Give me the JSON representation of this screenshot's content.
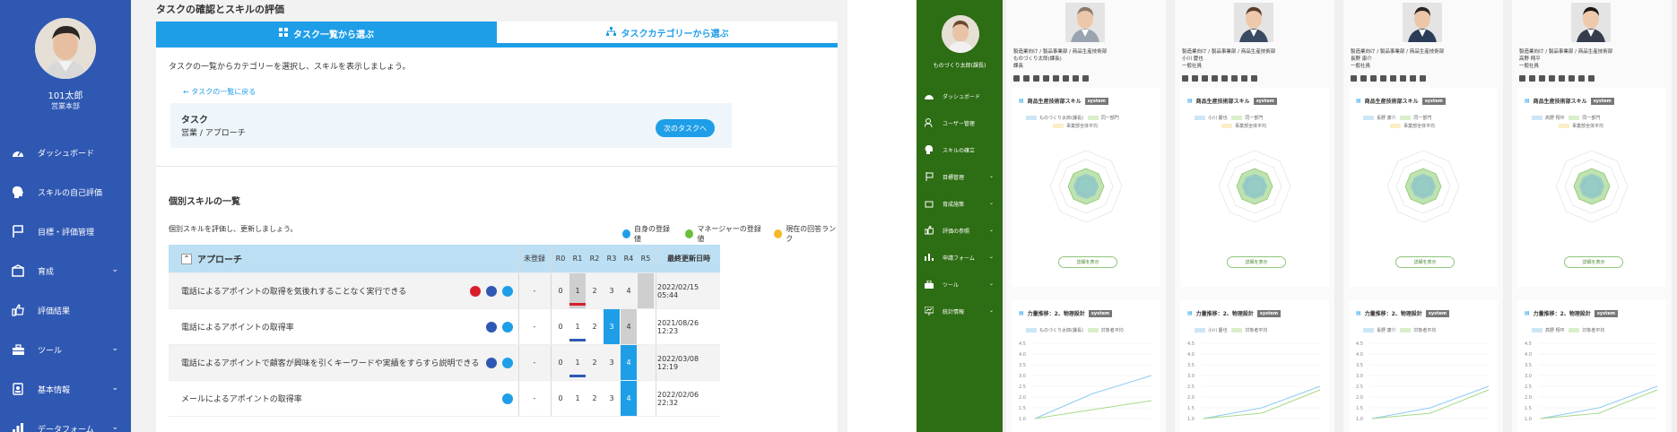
{
  "left": {
    "sidebar": {
      "user_name": "101太郎",
      "user_dept": "営業本部",
      "items": [
        {
          "label": "ダッシュボード",
          "icon": "dashboard-icon",
          "chevron": false
        },
        {
          "label": "スキルの自己評価",
          "icon": "head-icon",
          "chevron": false
        },
        {
          "label": "目標・評価管理",
          "icon": "flag-icon",
          "chevron": false
        },
        {
          "label": "育成",
          "icon": "training-icon",
          "chevron": true
        },
        {
          "label": "評価結果",
          "icon": "thumbs-up-icon",
          "chevron": false
        },
        {
          "label": "ツール",
          "icon": "toolbox-icon",
          "chevron": true
        },
        {
          "label": "基本情報",
          "icon": "id-card-icon",
          "chevron": true
        },
        {
          "label": "データフォーム",
          "icon": "data-form-icon",
          "chevron": true
        }
      ]
    },
    "header": {
      "title": "タスクの確認とスキルの評価"
    },
    "tabs": [
      {
        "label": "タスク一覧から選ぶ",
        "icon": "grid-icon"
      },
      {
        "label": "タスクカテゴリーから選ぶ",
        "icon": "hierarchy-icon"
      }
    ],
    "intro": "タスクの一覧からカテゴリーを選択し、スキルを表示しましょう。",
    "back_link": "タスクの一覧に戻る",
    "task": {
      "label": "タスク",
      "value": "営業 / アプローチ",
      "next_button": "次のタスクへ"
    },
    "skills": {
      "title": "個別スキルの一覧",
      "description": "個別スキルを評価し、更新しましょう。",
      "legend": [
        {
          "label": "自身の登録値",
          "color": "#1f9ee8"
        },
        {
          "label": "マネージャーの登録値",
          "color": "#6bbf3a"
        },
        {
          "label": "現在の回答ランク",
          "color": "#f2b92b"
        }
      ],
      "columns": {
        "group": "アプローチ",
        "unregistered": "未登録",
        "r0": "R0",
        "r1": "R1",
        "r2": "R2",
        "r3": "R3",
        "r4": "R4",
        "r5": "R5",
        "updated": "最終更新日時"
      },
      "rows": [
        {
          "name": "電話によるアポイントの取得を気後れすることなく実行できる",
          "dash": "-",
          "r0": "0",
          "r1": "1",
          "r2": "2",
          "r3": "3",
          "r4": "4",
          "date": "2022/02/15 05:44"
        },
        {
          "name": "電話によるアポイントの取得率",
          "dash": "-",
          "r0": "0",
          "r1": "1",
          "r2": "2",
          "r3": "3",
          "r4": "4",
          "date": "2021/08/26 12:23"
        },
        {
          "name": "電話によるアポイントで顧客が興味を引くキーワードや実績をすらすら説明できる",
          "dash": "-",
          "r0": "0",
          "r1": "1",
          "r2": "2",
          "r3": "3",
          "r4": "4",
          "date": "2022/03/08 12:19"
        },
        {
          "name": "メールによるアポイントの取得率",
          "dash": "-",
          "r0": "0",
          "r1": "1",
          "r2": "2",
          "r3": "3",
          "r4": "4",
          "date": "2022/02/06 22:32"
        }
      ]
    }
  },
  "right": {
    "sidebar": {
      "user_name": "ものづくり太郎(課長)",
      "items": [
        {
          "label": "ダッシュボード",
          "icon": "dashboard-icon",
          "chevron": false
        },
        {
          "label": "ユーザー管理",
          "icon": "users-icon",
          "chevron": false
        },
        {
          "label": "スキルの確立",
          "icon": "head-icon",
          "chevron": false
        },
        {
          "label": "目標管理",
          "icon": "flag-icon",
          "chevron": true
        },
        {
          "label": "育成施策",
          "icon": "training-icon",
          "chevron": true
        },
        {
          "label": "評価の参照",
          "icon": "thumbs-up-icon",
          "chevron": true
        },
        {
          "label": "申請フォーム",
          "icon": "form-icon",
          "chevron": true
        },
        {
          "label": "ツール",
          "icon": "toolbox-icon",
          "chevron": true
        },
        {
          "label": "統計情報",
          "icon": "stats-icon",
          "chevron": true
        }
      ]
    },
    "members": [
      {
        "org": "製造業向け / 製品事業部 / 商品生産技術部",
        "name": "ものづくり太郎(課長)",
        "role": "課長",
        "legend_self": "ものづくり太郎(課長)",
        "legend_dept": "同一部門",
        "legend_avg": "事業部全体平均"
      },
      {
        "org": "製造業向け / 製品事業部 / 商品生産技術部",
        "name": "小川 慶也",
        "role": "一般社員",
        "legend_self": "小川 慶也",
        "legend_dept": "同一部門",
        "legend_avg": "事業部全体平均"
      },
      {
        "org": "製造業向け / 製品事業部 / 商品生産技術部",
        "name": "長野 康介",
        "role": "一般社員",
        "legend_self": "長野 康介",
        "legend_dept": "同一部門",
        "legend_avg": "事業部全体平均"
      },
      {
        "org": "製造業向け / 製品事業部 / 商品生産技術部",
        "name": "高野 翔平",
        "role": "一般社員",
        "legend_self": "高野 翔平",
        "legend_dept": "同一部門",
        "legend_avg": "事業部全体平均"
      }
    ],
    "panel1": {
      "title": "商品生産技術部スキル",
      "badge": "system",
      "button": "詳細を表示"
    },
    "panel2": {
      "title": "力量推移：2、物理設計",
      "badge": "system",
      "legend_dept": "対象者平均"
    },
    "yticks": [
      "4.5",
      "4.0",
      "3.5",
      "3.0",
      "2.5",
      "2.0",
      "1.5",
      "1.0"
    ]
  }
}
